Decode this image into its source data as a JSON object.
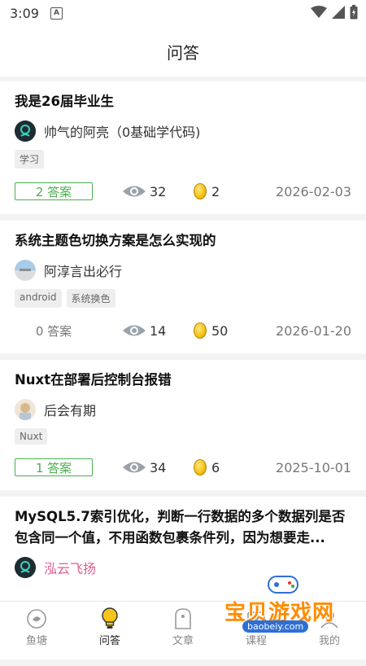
{
  "status": {
    "time": "3:09",
    "notif": "A"
  },
  "header": {
    "title": "问答"
  },
  "questions": [
    {
      "title": "我是26届毕业生",
      "author": "帅气的阿亮（0基础学代码)",
      "tags": [
        "学习"
      ],
      "answers": "2 答案",
      "views": "32",
      "coins": "2",
      "date": "2026-02-03"
    },
    {
      "title": "系统主题色切换方案是怎么实现的",
      "author": "阿淳言出必行",
      "tags": [
        "android",
        "系统换色"
      ],
      "answers": "0 答案",
      "views": "14",
      "coins": "50",
      "date": "2026-01-20"
    },
    {
      "title": "Nuxt在部署后控制台报错",
      "author": "后会有期",
      "tags": [
        "Nuxt"
      ],
      "answers": "1 答案",
      "views": "34",
      "coins": "6",
      "date": "2025-10-01"
    },
    {
      "title": "MySQL5.7索引优化，判断一行数据的多个数据列是否包含同一个值，不用函数包裹条件列，因为想要走...",
      "author": "泓云飞扬"
    }
  ],
  "tabs": [
    {
      "label": "鱼塘",
      "icon": "fishpond-icon"
    },
    {
      "label": "问答",
      "icon": "lightbulb-icon"
    },
    {
      "label": "文章",
      "icon": "article-icon"
    },
    {
      "label": "课程",
      "icon": "course-icon"
    },
    {
      "label": "我的",
      "icon": "profile-icon"
    }
  ],
  "watermark": {
    "text": "宝贝游戏网",
    "url": "baobeiy.com"
  },
  "colors": {
    "accent": "#4caf50",
    "author_pink": "#e25c8e",
    "coin": "#f5c518"
  }
}
